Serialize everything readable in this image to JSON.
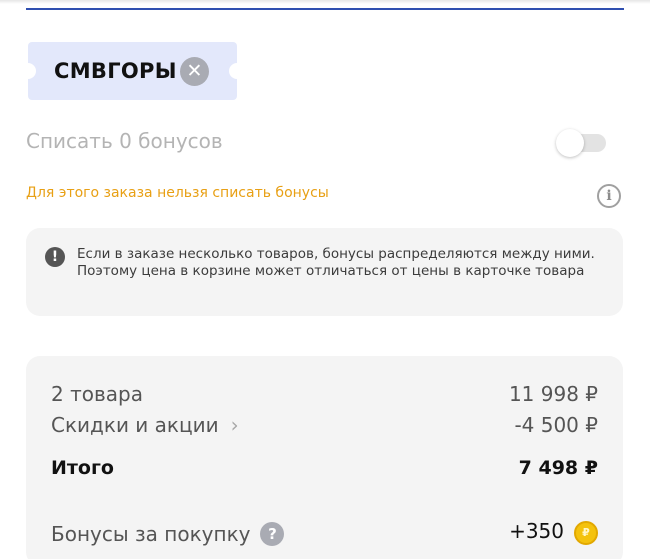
{
  "promo": {
    "code": "СМВГОРЫ",
    "remove_icon": "close-icon",
    "remove_glyph": "✕"
  },
  "bonus": {
    "label": "Списать 0 бонусов",
    "toggle_on": false,
    "warning": "Для этого заказа нельзя списать бонусы",
    "info_glyph": "i"
  },
  "notice": {
    "icon_glyph": "!",
    "text": "Если в заказе несколько товаров, бонусы распределяются между ними. Поэтому цена в корзине может отличаться от цены в карточке товара"
  },
  "summary": {
    "items_label": "2 товара",
    "items_value": "11 998 ₽",
    "discounts_label": "Скидки и акции",
    "discounts_chevron": "›",
    "discounts_value": "-4 500 ₽",
    "total_label": "Итого",
    "total_value": "7 498 ₽",
    "bonus_label": "Бонусы за покупку",
    "bonus_help_glyph": "?",
    "bonus_value": "+350",
    "coin_glyph": "₽"
  },
  "colors": {
    "accent_blue": "#2f4fb0",
    "warning_orange": "#e8a015",
    "coin_yellow": "#f4c20d",
    "coupon_bg": "#e3e8fb"
  }
}
